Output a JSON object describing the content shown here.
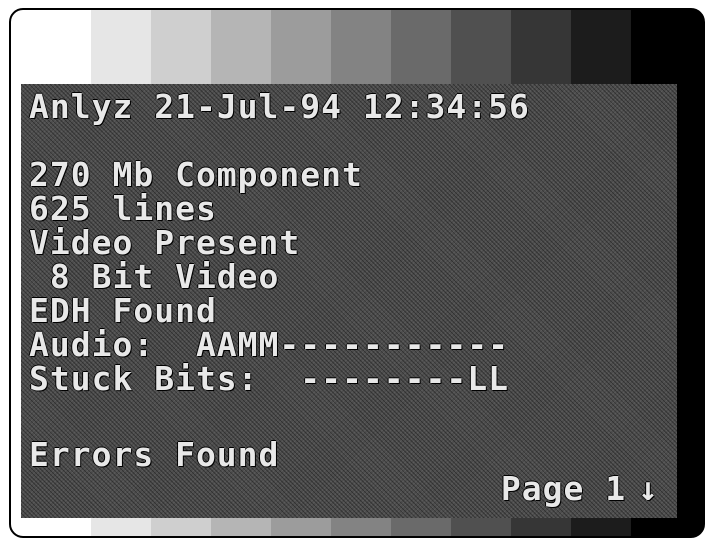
{
  "header": {
    "mode": "Anlyz",
    "date": "21-Jul-94",
    "time": "12:34:56"
  },
  "status_lines": [
    "270 Mb Component",
    "625 lines",
    "Video Present",
    " 8 Bit Video",
    "EDH Found",
    "Audio:  AAMM-----------",
    "Stuck Bits:  --------LL"
  ],
  "errors_label": "Errors Found",
  "pager": {
    "label": "Page 1",
    "arrow_icon": "arrow-down-icon",
    "arrow_glyph": "↓"
  },
  "colors": {
    "text": "#e8e8e8",
    "panel": "#4d4d4d",
    "frame": "#000000"
  }
}
